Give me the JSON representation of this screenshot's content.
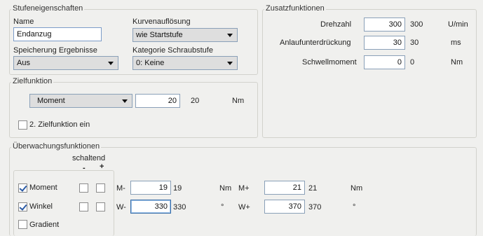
{
  "stufe": {
    "group_title": "Stufeneigenschaften",
    "name_label": "Name",
    "name_value": "Endanzug",
    "kurven_label": "Kurvenauflösung",
    "kurven_value": "wie Startstufe",
    "speicherung_label": "Speicherung Ergebnisse",
    "speicherung_value": "Aus",
    "kategorie_label": "Kategorie Schraubstufe",
    "kategorie_value": "0: Keine"
  },
  "ziel": {
    "group_title": "Zielfunktion",
    "function_value": "Moment",
    "input_value": "20",
    "actual_value": "20",
    "unit": "Nm",
    "second_label": "2. Zielfunktion ein",
    "second_checked": false
  },
  "zusatz": {
    "group_title": "Zusatzfunktionen",
    "rows": [
      {
        "label": "Drehzahl",
        "input": "300",
        "actual": "300",
        "unit": "U/min"
      },
      {
        "label": "Anlaufunterdrückung",
        "input": "30",
        "actual": "30",
        "unit": "ms"
      },
      {
        "label": "Schwellmoment",
        "input": "0",
        "actual": "0",
        "unit": "Nm"
      }
    ]
  },
  "ueber": {
    "group_title": "Überwachungsfunktionen",
    "schaltend_label": "schaltend",
    "minus_header": "-",
    "plus_header": "+",
    "rows": [
      {
        "label": "Moment",
        "checked": true,
        "min_label": "M-",
        "min_input": "19",
        "min_actual": "19",
        "min_unit": "Nm",
        "max_label": "M+",
        "max_input": "21",
        "max_actual": "21",
        "max_unit": "Nm"
      },
      {
        "label": "Winkel",
        "checked": true,
        "min_label": "W-",
        "min_input": "330",
        "min_actual": "330",
        "min_unit": "°",
        "max_label": "W+",
        "max_input": "370",
        "max_actual": "370",
        "max_unit": "°"
      },
      {
        "label": "Gradient",
        "checked": false
      }
    ]
  }
}
